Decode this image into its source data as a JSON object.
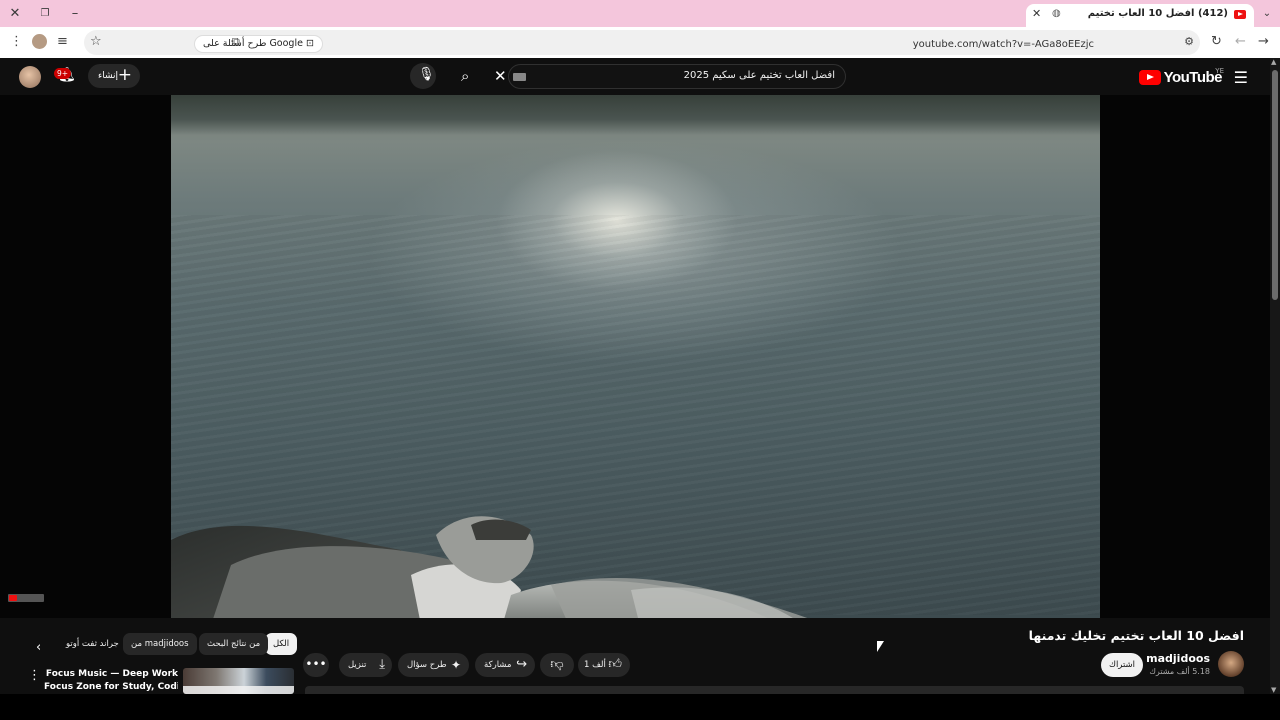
{
  "browser": {
    "tab": {
      "title": "(412) افضل 10 العاب تختيم"
    },
    "address": {
      "url": "youtube.com/watch?v=-AGa8oEEzjc",
      "google_chip": "طرح أسئلة على Google"
    }
  },
  "youtube": {
    "logo_text": "YouTube",
    "country_code": "YE",
    "search_query": "افضل العاب تختيم على سكيم 2025",
    "create_label": "إنشاء",
    "notification_count": "9+",
    "watermark_text": "YouTube"
  },
  "video": {
    "title": "افضل 10 العاب تختيم تخليك تدمنها",
    "channel_name": "madjidoos",
    "channel_subs": "5.18 ألف مشترك",
    "subscribe_label": "اشتراك",
    "likes_label": "1 ألف",
    "share_label": "مشاركة",
    "ask_label": "طرح سؤال",
    "download_label": "تنزيل"
  },
  "chips": [
    {
      "label": "الكل",
      "active": true
    },
    {
      "label": "من نتائج البحث",
      "active": false
    },
    {
      "label": "من madjidoos",
      "active": false
    },
    {
      "label": "جراند ثفت أوتو",
      "active": false
    }
  ],
  "recommendation": {
    "title_line1": "Focus Music — Deep Work",
    "title_line2": "Focus Zone for Study, Coding &..."
  },
  "icons": {
    "accent": "#ff0000",
    "tab_strip_color": "#f4c6dc",
    "badge_color": "#cc0000"
  }
}
